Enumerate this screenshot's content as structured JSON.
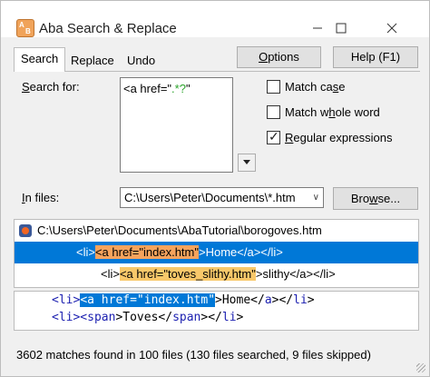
{
  "window": {
    "title": "Aba Search & Replace",
    "icon_text": "AB"
  },
  "tabs": [
    {
      "label": "Search"
    },
    {
      "label": "Replace"
    },
    {
      "label": "Undo"
    }
  ],
  "buttons": {
    "options": "Options",
    "help": "Help (F1)",
    "browse": "Browse..."
  },
  "search": {
    "label": "Search for:",
    "value_prefix": "<a href=\"",
    "value_regex": ".*?",
    "value_suffix": "\""
  },
  "options": [
    {
      "label": "Match case",
      "checked": false
    },
    {
      "label": "Match whole word",
      "checked": false
    },
    {
      "label": "Regular expressions",
      "checked": true
    }
  ],
  "files": {
    "label": "In files:",
    "value": "C:\\Users\\Peter\\Documents\\*.htm"
  },
  "results": {
    "file_path": "C:\\Users\\Peter\\Documents\\AbaTutorial\\borogoves.htm",
    "row1": {
      "before": "<li>",
      "match": "<a href=\"index.htm\"",
      "after": ">Home</a></li>"
    },
    "row2": {
      "before": "<li>",
      "match": "<a href=\"toves_slithy.htm\"",
      "after": ">slithy</a></li>"
    }
  },
  "preview": {
    "line1": {
      "t1": "<li>",
      "match": "<a href=\"index.htm\"",
      "t2": ">Home</",
      "t3": "a",
      "t4": "></",
      "t5": "li",
      "t6": ">"
    },
    "line2": {
      "t1": "<li><",
      "t2": "span",
      "t3": ">Toves</",
      "t4": "span",
      "t5": "></",
      "t6": "li",
      "t7": ">"
    }
  },
  "status": "3602 matches found in 100 files (130 files searched, 9 files skipped)",
  "colors": {
    "selection": "#0078d7",
    "match_highlight": "#f7a35c",
    "regex_green": "#2aa32a",
    "tag_blue": "#1b1fb0"
  }
}
